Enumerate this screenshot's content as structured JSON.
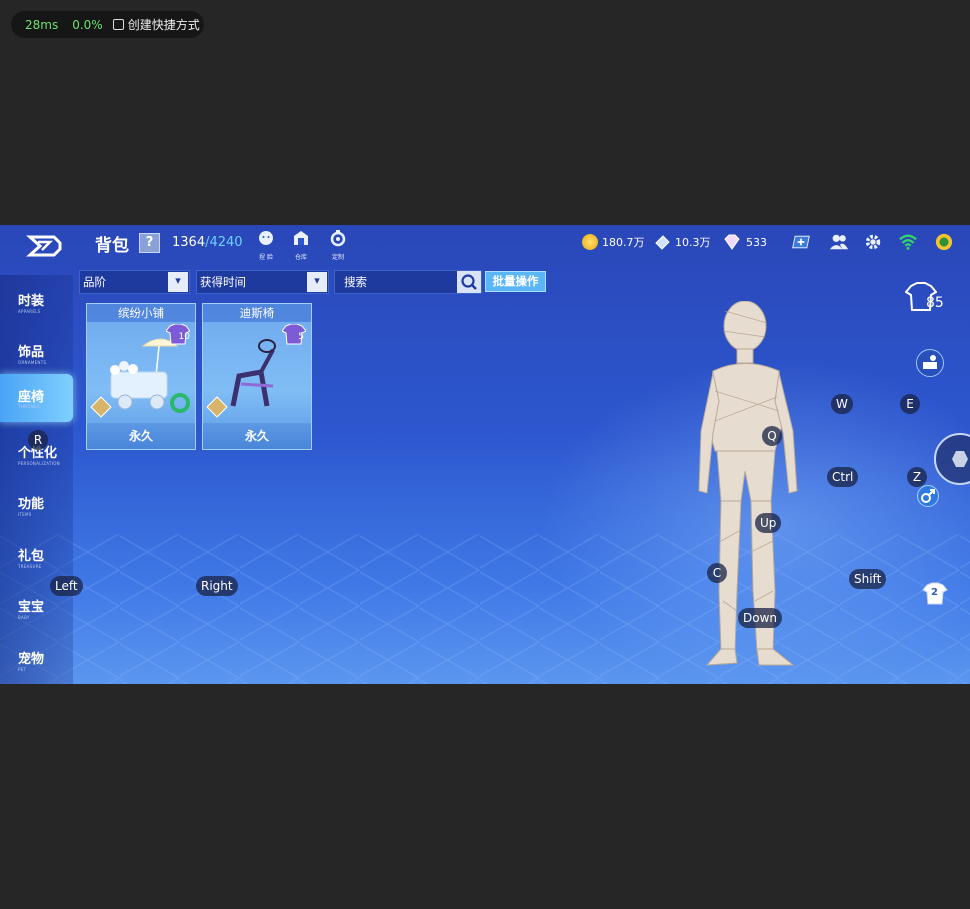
{
  "overlay": {
    "latency": "28ms",
    "loss": "0.0%",
    "shortcut_label": "创建快捷方式"
  },
  "header": {
    "title": "背包",
    "help": "?",
    "count_current": "1364",
    "count_max": "/4240",
    "actions": [
      {
        "icon": "face-icon",
        "label": "捏 脸"
      },
      {
        "icon": "warehouse-icon",
        "label": "仓库"
      },
      {
        "icon": "customize-icon",
        "label": "定制"
      }
    ],
    "coins": "180.7万",
    "tickets": "10.3万",
    "diamonds": "533"
  },
  "sidebar": {
    "items": [
      {
        "zh": "时装",
        "en": "APPARELS"
      },
      {
        "zh": "饰品",
        "en": "ORNAMENTS"
      },
      {
        "zh": "座椅",
        "en": "THRONES"
      },
      {
        "zh": "个性化",
        "en": "PERSONALIZATION"
      },
      {
        "zh": "功能",
        "en": "ITEMS"
      },
      {
        "zh": "礼包",
        "en": "TREASURE"
      },
      {
        "zh": "宝宝",
        "en": "BABY"
      },
      {
        "zh": "宠物",
        "en": "PET"
      }
    ]
  },
  "filters": {
    "quality": "品阶",
    "obtain_time": "获得时间",
    "search": "搜索",
    "batch": "批量操作",
    "arrow": "▾"
  },
  "cards": [
    {
      "name": "缤纷小铺",
      "badge": "10",
      "duration": "永久"
    },
    {
      "name": "迪斯椅",
      "badge": "5",
      "duration": "永久"
    }
  ],
  "right_panel": {
    "outfit_count": "85",
    "slot_number": "2"
  },
  "keys": {
    "w": "W",
    "e": "E",
    "q": "Q",
    "r": "R",
    "ctrl": "Ctrl",
    "z": "Z",
    "up": "Up",
    "c": "C",
    "shift": "Shift",
    "down": "Down",
    "left": "Left",
    "right": "Right"
  },
  "colors": {
    "accent": "#5ab6f7",
    "game_bg": "#2d57cf",
    "active_tab": "#7fd0ff"
  }
}
